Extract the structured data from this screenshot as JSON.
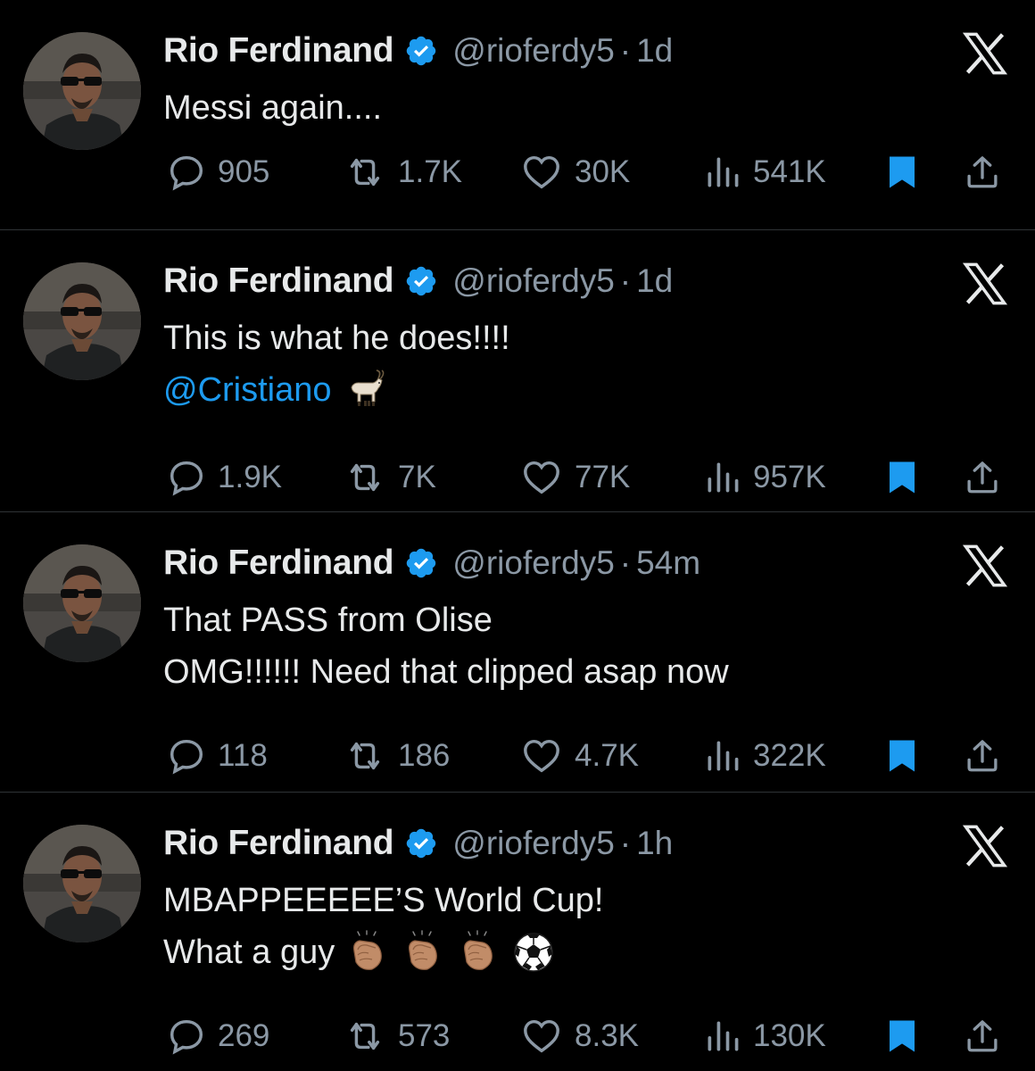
{
  "brand_color": "#1d9bf0",
  "tweets": [
    {
      "name": "Rio Ferdinand",
      "handle": "@rioferdy5",
      "separator": "·",
      "time": "1d",
      "lines": [
        {
          "text": "Messi again....",
          "mention": "",
          "emoji": ""
        }
      ],
      "replies": "905",
      "reposts": "1.7K",
      "likes": "30K",
      "views": "541K"
    },
    {
      "name": "Rio Ferdinand",
      "handle": "@rioferdy5",
      "separator": "·",
      "time": "1d",
      "lines": [
        {
          "text": "This is what he does!!!!",
          "mention": "",
          "emoji": ""
        },
        {
          "text": "",
          "mention": "@Cristiano",
          "emoji": "goat"
        }
      ],
      "replies": "1.9K",
      "reposts": "7K",
      "likes": "77K",
      "views": "957K"
    },
    {
      "name": "Rio Ferdinand",
      "handle": "@rioferdy5",
      "separator": "·",
      "time": "54m",
      "lines": [
        {
          "text": "That PASS from Olise",
          "mention": "",
          "emoji": ""
        },
        {
          "text": "OMG!!!!!! Need that clipped asap now",
          "mention": "",
          "emoji": ""
        }
      ],
      "replies": "118",
      "reposts": "186",
      "likes": "4.7K",
      "views": "322K"
    },
    {
      "name": "Rio Ferdinand",
      "handle": "@rioferdy5",
      "separator": "·",
      "time": "1h",
      "lines": [
        {
          "text": "MBAPPEEEEE’S World Cup!",
          "mention": "",
          "emoji": ""
        },
        {
          "text": "What a guy",
          "mention": "",
          "emoji": "clap-clap-clap-ball"
        }
      ],
      "replies": "269",
      "reposts": "573",
      "likes": "8.3K",
      "views": "130K"
    }
  ],
  "icons": {
    "verified": "verified-badge-icon",
    "x": "x-logo-icon",
    "reply": "reply-icon",
    "repost": "repost-icon",
    "like": "heart-icon",
    "views": "views-icon",
    "bookmark": "bookmark-icon",
    "share": "share-icon"
  }
}
